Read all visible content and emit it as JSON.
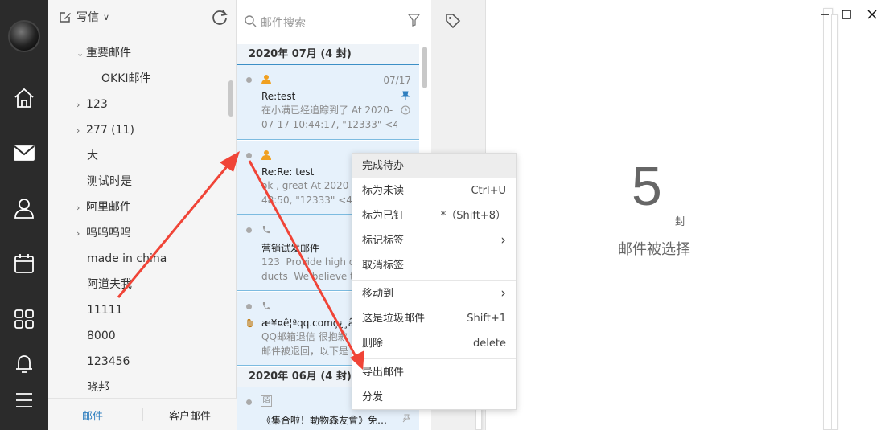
{
  "folders": {
    "compose_label": "写信",
    "items": [
      {
        "label": "重要邮件",
        "arrow": "⌄"
      },
      {
        "label": "OKKI邮件",
        "arrow": ""
      },
      {
        "label": "123",
        "arrow": "›"
      },
      {
        "label": "277 (11)",
        "arrow": "›"
      },
      {
        "label": "大",
        "arrow": ""
      },
      {
        "label": "测试时是",
        "arrow": ""
      },
      {
        "label": "阿里邮件",
        "arrow": "›"
      },
      {
        "label": "呜呜呜呜",
        "arrow": "›"
      },
      {
        "label": "made in china",
        "arrow": ""
      },
      {
        "label": "阿道夫我",
        "arrow": ""
      },
      {
        "label": "11111",
        "arrow": ""
      },
      {
        "label": "8000",
        "arrow": ""
      },
      {
        "label": "123456",
        "arrow": ""
      },
      {
        "label": "晓邦",
        "arrow": ""
      }
    ],
    "footer_tabs": [
      "邮件",
      "客户邮件"
    ]
  },
  "list": {
    "search_placeholder": "邮件搜索",
    "groups": [
      "2020年 07月 (4 封)",
      "2020年 06月 (4 封)"
    ],
    "mails": [
      {
        "subject": "Re:test",
        "date": "07/17",
        "preview_line1": "在小满已经追踪到了 At 2020-",
        "preview_line2": "07-17 10:44:17, \"12333\" <40"
      },
      {
        "subject": "Re:Re: test",
        "date": "",
        "preview_line1": "ok , great At 2020-0",
        "preview_line2": "48:50, \"12333\" <40"
      },
      {
        "subject": "营销试发邮件",
        "date": "",
        "preview_line1": "123  Provide high q",
        "preview_line2": "ducts  We believe t"
      },
      {
        "subject": "æ¥¤ê¦ªqq.comç¿¸â¿",
        "date": "",
        "preview_line1": "QQ邮箱退信 很抱歉",
        "preview_line2": "邮件被退回，以下是"
      },
      {
        "subject": "《集合啦！動物森友會》免費...",
        "date": "",
        "preview_line1": "",
        "preview_line2": ""
      }
    ],
    "badge_text": "陌"
  },
  "context_menu": {
    "items": [
      {
        "label": "完成待办",
        "shortcut": ""
      },
      {
        "label": "标为未读",
        "shortcut": "Ctrl+U"
      },
      {
        "label": "标为已钉",
        "shortcut": "*（Shift+8）"
      },
      {
        "label": "标记标签",
        "shortcut": "›"
      },
      {
        "label": "取消标签",
        "shortcut": ""
      },
      {
        "label": "移动到",
        "shortcut": "›"
      },
      {
        "label": "这是垃圾邮件",
        "shortcut": "Shift+1"
      },
      {
        "label": "删除",
        "shortcut": "delete"
      },
      {
        "label": "导出邮件",
        "shortcut": ""
      },
      {
        "label": "分发",
        "shortcut": ""
      }
    ]
  },
  "reader": {
    "count": "5",
    "count_unit": "封",
    "selected_label": "邮件被选择"
  },
  "colors": {
    "accent": "#3c8fc6",
    "arrow": "#f04437",
    "nav_bg": "#2b2b2b"
  }
}
